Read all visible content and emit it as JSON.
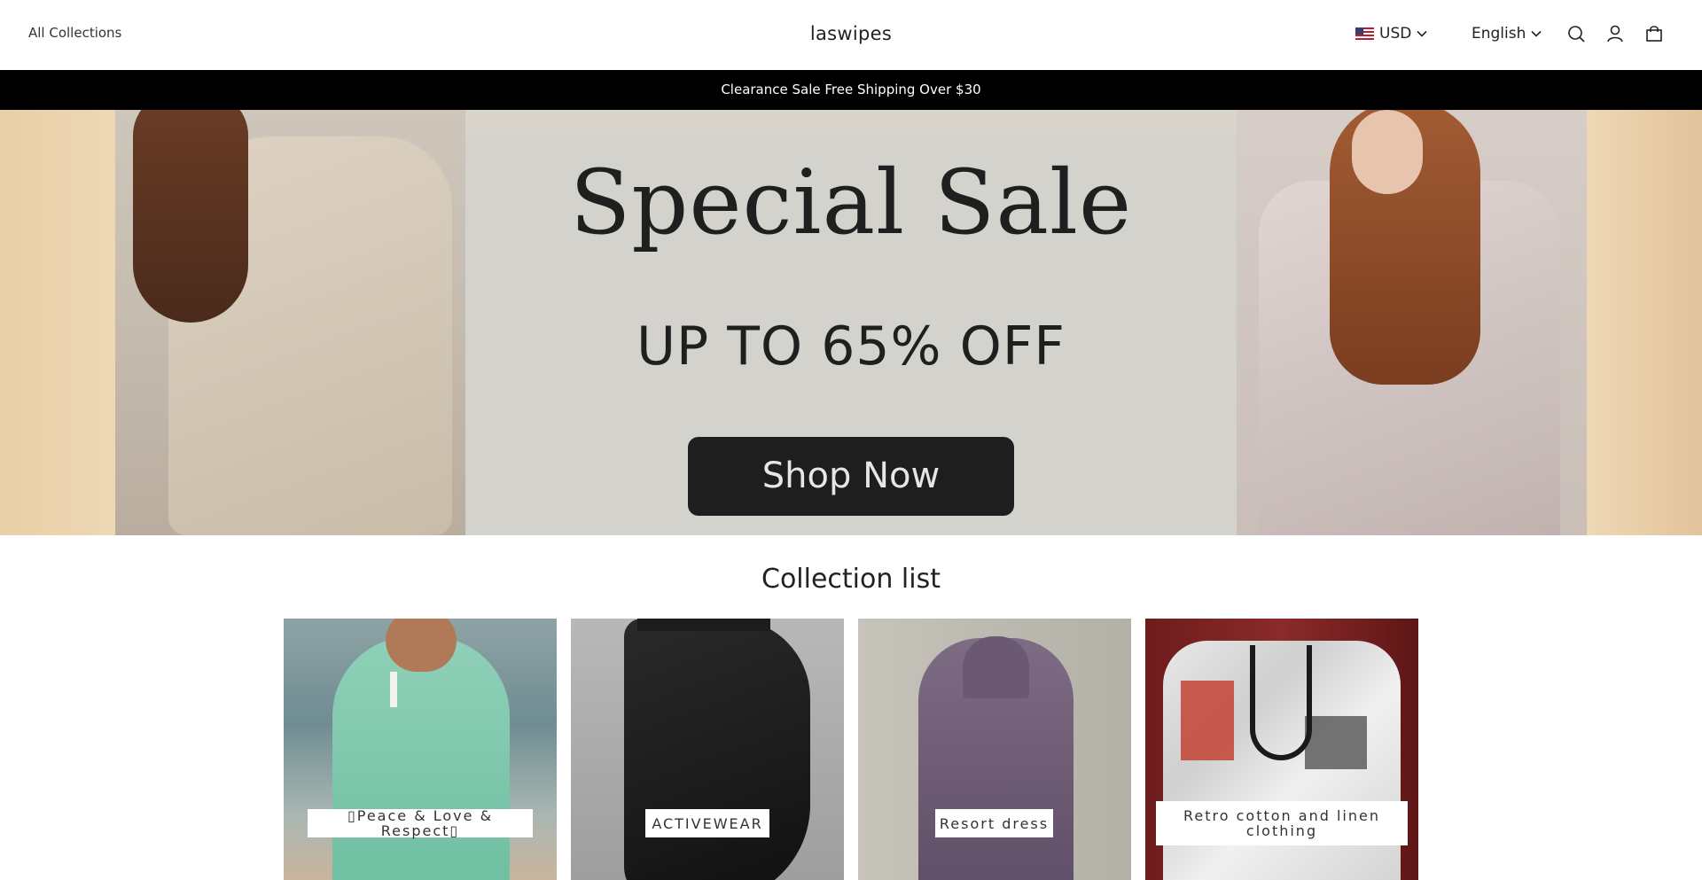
{
  "header": {
    "nav_link": "All Collections",
    "brand": "laswipes",
    "currency": "USD",
    "language": "English",
    "icons": [
      "us-flag-icon",
      "chevron-down-icon",
      "search-icon",
      "account-icon",
      "cart-icon"
    ]
  },
  "announcement": "Clearance Sale Free Shipping Over $30",
  "hero": {
    "title": "Special Sale",
    "subtitle": "UP TO 65% OFF",
    "button": "Shop Now"
  },
  "collection_list": {
    "title": "Collection list",
    "items": [
      {
        "label": "▯Peace & Love & Respect▯"
      },
      {
        "label": "ACTIVEWEAR"
      },
      {
        "label": "Resort dress"
      },
      {
        "label": "Retro cotton and linen clothing"
      }
    ]
  },
  "colors": {
    "announcement_bg": "#000000",
    "hero_panel": "#d3d2cc",
    "button_bg": "#1e1e1e"
  }
}
